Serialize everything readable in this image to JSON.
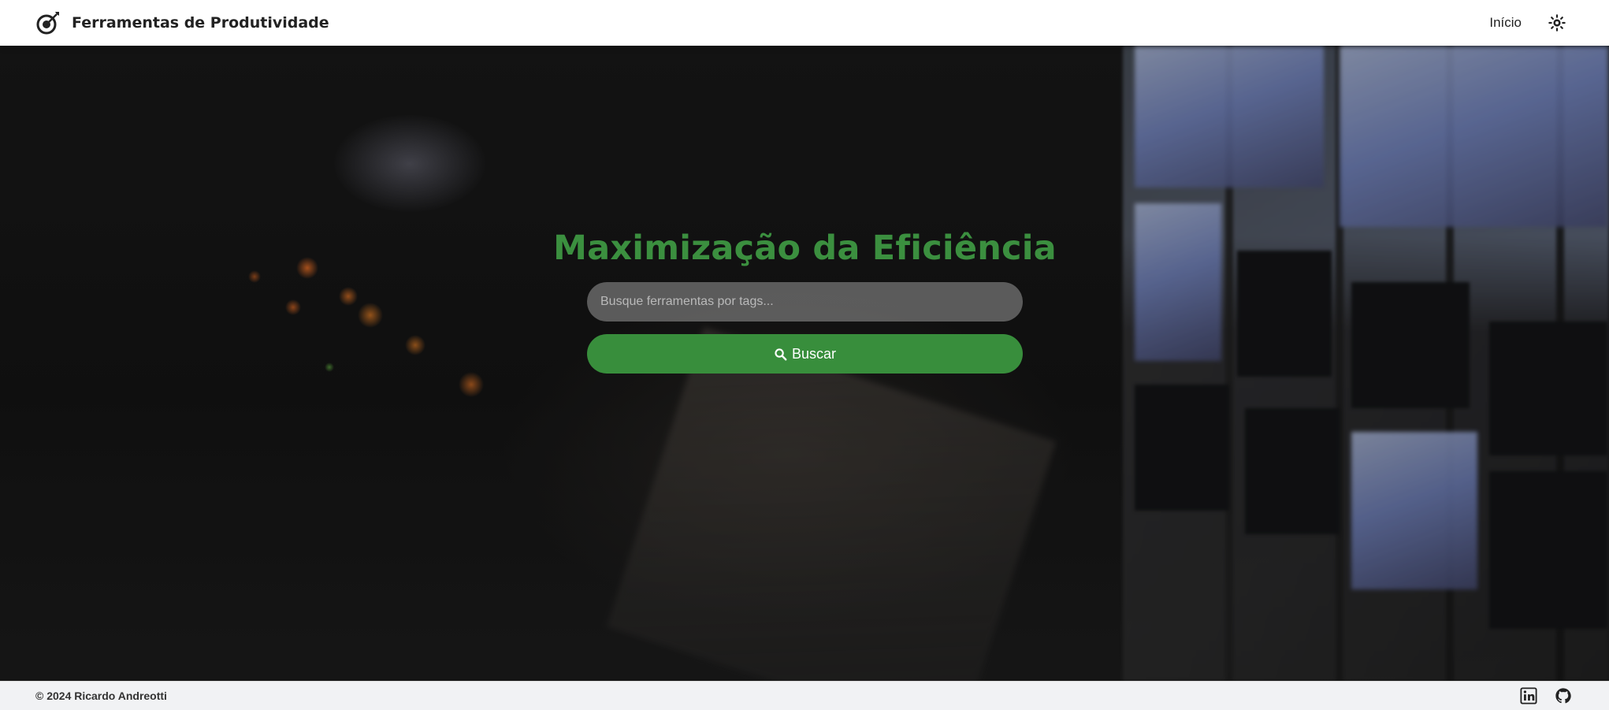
{
  "header": {
    "brand_title": "Ferramentas de Produtividade",
    "logo_icon": "target-arrow-icon",
    "nav_link": "Início",
    "theme_toggle_icon": "sun-icon"
  },
  "hero": {
    "title": "Maximização da Eficiência",
    "search_placeholder": "Busque ferramentas por tags...",
    "search_button_label": "Buscar",
    "search_button_icon": "search-icon"
  },
  "footer": {
    "copyright": "© 2024 Ricardo Andreotti",
    "social": [
      "linkedin-icon",
      "github-icon"
    ]
  },
  "colors": {
    "accent": "#388e3c",
    "title": "#3b8f3f",
    "header_bg": "#ffffff",
    "footer_bg": "#f1f2f4"
  }
}
